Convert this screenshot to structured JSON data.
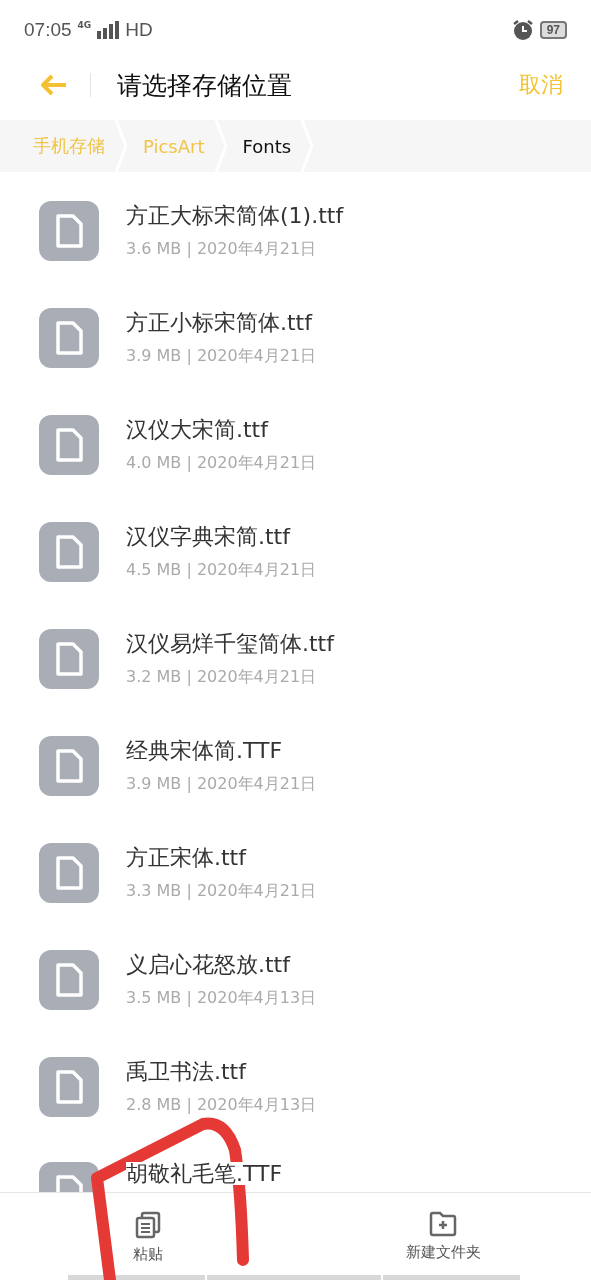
{
  "status_bar": {
    "time": "07:05",
    "network": "4G",
    "hd": "HD",
    "battery": "97"
  },
  "header": {
    "title": "请选择存储位置",
    "cancel": "取消"
  },
  "breadcrumbs": [
    {
      "label": "手机存储",
      "selected": false
    },
    {
      "label": "PicsArt",
      "selected": false
    },
    {
      "label": "Fonts",
      "selected": true
    }
  ],
  "files": [
    {
      "name": "方正大标宋简体(1).ttf",
      "meta": "3.6 MB | 2020年4月21日"
    },
    {
      "name": "方正小标宋简体.ttf",
      "meta": "3.9 MB | 2020年4月21日"
    },
    {
      "name": "汉仪大宋简.ttf",
      "meta": "4.0 MB | 2020年4月21日"
    },
    {
      "name": "汉仪字典宋简.ttf",
      "meta": "4.5 MB | 2020年4月21日"
    },
    {
      "name": "汉仪易烊千玺简体.ttf",
      "meta": "3.2 MB | 2020年4月21日"
    },
    {
      "name": "经典宋体简.TTF",
      "meta": "3.9 MB | 2020年4月21日"
    },
    {
      "name": "方正宋体.ttf",
      "meta": "3.3 MB | 2020年4月21日"
    },
    {
      "name": "义启心花怒放.ttf",
      "meta": "3.5 MB | 2020年4月13日"
    },
    {
      "name": "禹卫书法.ttf",
      "meta": "2.8 MB | 2020年4月13日"
    },
    {
      "name": "胡敬礼毛笔.TTF"
    }
  ],
  "toolbar": [
    {
      "kind": "paste",
      "label": "粘贴"
    },
    {
      "kind": "new-folder",
      "label": "新建文件夹"
    }
  ]
}
